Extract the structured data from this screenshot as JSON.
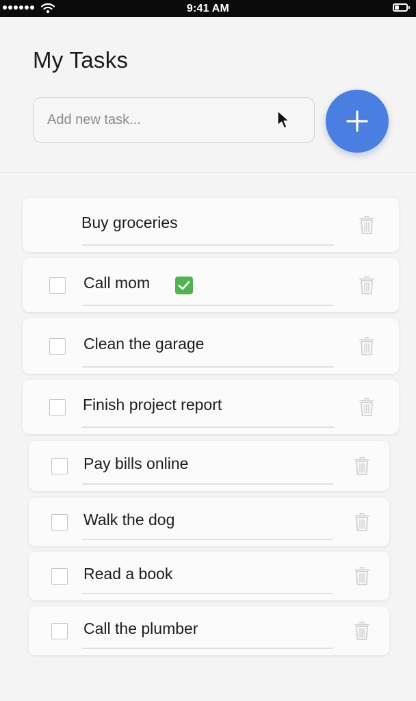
{
  "status_bar": {
    "time": "9:41 AM",
    "signal_icon": "signal-dots-icon",
    "wifi_icon": "wifi-icon",
    "battery_icon": "battery-icon"
  },
  "header": {
    "title": "My Tasks",
    "input": {
      "placeholder": "Add new task...",
      "value": ""
    },
    "add_button_icon": "plus-icon"
  },
  "tasks": [
    {
      "label": "Buy groceries",
      "checkbox_visible": false,
      "completed": false
    },
    {
      "label": "Call mom",
      "checkbox_visible": true,
      "completed": true
    },
    {
      "label": "Clean the garage",
      "checkbox_visible": true,
      "completed": false
    },
    {
      "label": "Finish project report",
      "checkbox_visible": true,
      "completed": false
    },
    {
      "label": "Pay bills online",
      "checkbox_visible": true,
      "completed": false
    },
    {
      "label": "Walk the dog",
      "checkbox_visible": true,
      "completed": false
    },
    {
      "label": "Read a book",
      "checkbox_visible": true,
      "completed": false
    },
    {
      "label": "Call the plumber",
      "checkbox_visible": true,
      "completed": false
    }
  ],
  "colors": {
    "accent": "#4a7ee0",
    "done_badge": "#4fb350",
    "status_bar": "#0b0b0b"
  },
  "icons": {
    "delete": "trash-icon",
    "done": "checkmark-icon"
  }
}
